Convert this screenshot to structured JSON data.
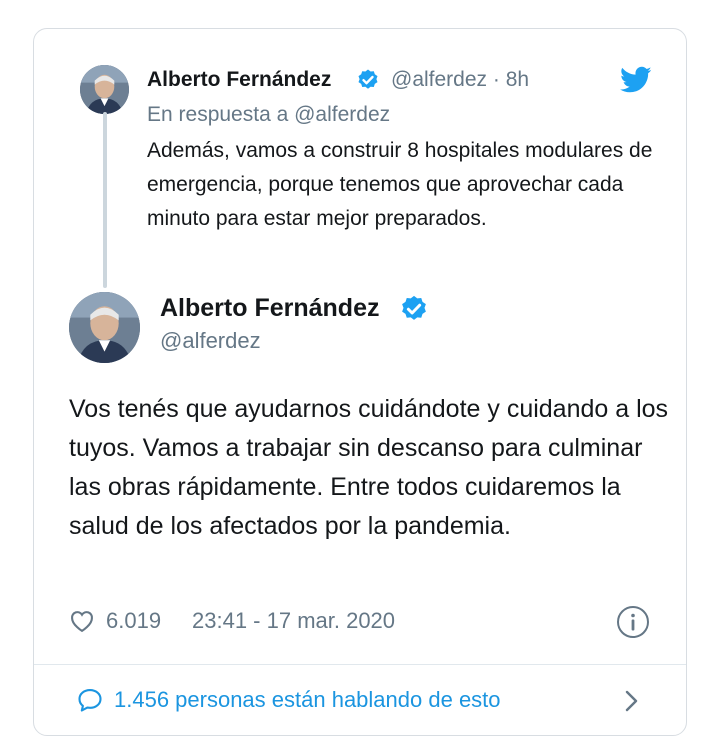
{
  "parent_tweet": {
    "author_name": "Alberto Fernández",
    "handle_time": "@alferdez · 8h",
    "reply_to": "En respuesta a @alferdez",
    "text": "Además, vamos a construir 8 hospitales modulares de emergencia, porque tenemos que aprovechar cada minuto para estar mejor preparados."
  },
  "main_tweet": {
    "author_name": "Alberto Fernández",
    "handle": "@alferdez",
    "text": "Vos tenés que ayudarnos cuidándote y cuidando a los tuyos. Vamos a trabajar sin descanso para culminar las obras rápidamente. Entre todos cuidaremos la salud de los afectados por la pandemia.",
    "likes": "6.019",
    "timestamp": "23:41 - 17 mar. 2020"
  },
  "footer": {
    "talking": "1.456 personas están hablando de esto"
  },
  "colors": {
    "accent": "#1b95e0",
    "verified": "#1da1f2",
    "secondary_text": "#657786"
  },
  "icons": [
    "verified-badge-icon",
    "twitter-bird-icon",
    "heart-icon",
    "info-icon",
    "comment-bubble-icon",
    "chevron-right-icon"
  ]
}
